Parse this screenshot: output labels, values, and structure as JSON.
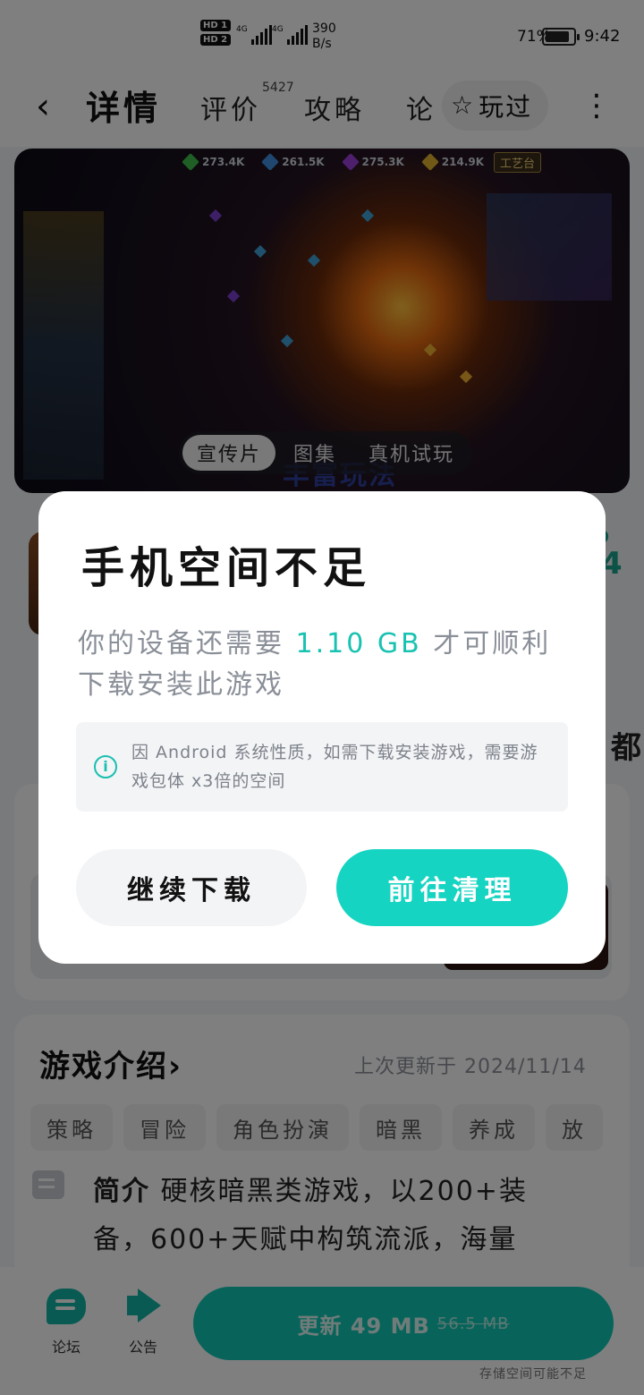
{
  "status_bar": {
    "sim1": "HD 1",
    "sim2": "HD 2",
    "net1": "4G",
    "net2": "4G",
    "speed_value": "390",
    "speed_unit": "B/s",
    "battery": "71%",
    "time": "9:42"
  },
  "header": {
    "tabs": [
      {
        "label": "详情",
        "active": true
      },
      {
        "label": "评价",
        "active": false
      },
      {
        "label": "攻略",
        "active": false
      },
      {
        "label": "论",
        "active": false
      }
    ],
    "review_count": "5427",
    "played_label": "玩过"
  },
  "video": {
    "stats": [
      {
        "value": "273.4K",
        "color": "#3fbf4a"
      },
      {
        "value": "261.5K",
        "color": "#3f8fe0"
      },
      {
        "value": "275.3K",
        "color": "#9b3fd8"
      },
      {
        "value": "214.9K",
        "color": "#e0b02c"
      }
    ],
    "craft_label": "工艺台",
    "caption": "丰富玩法",
    "tabs": [
      {
        "label": "宣传片",
        "active": true
      },
      {
        "label": "图集",
        "active": false
      },
      {
        "label": "真机试玩",
        "active": false
      }
    ]
  },
  "page_bg": {
    "right_badge": "p",
    "right_badge_num": "4",
    "dou": "都",
    "small_left": "《"
  },
  "intro": {
    "title": "游戏介绍",
    "chevron": "›",
    "updated": "上次更新于 2024/11/14",
    "tags": [
      "策略",
      "冒险",
      "角色扮演",
      "暗黑",
      "养成",
      "放"
    ],
    "body_label": "简介",
    "body_text": "硬核暗黑类游戏，以200+装备，600+天赋中构筑流派，海量"
  },
  "bottom_bar": {
    "forum_label": "论坛",
    "notice_label": "公告",
    "update_label": "更新 49 MB",
    "update_old_size": "56.5 MB",
    "storage_note": "存储空间可能不足"
  },
  "dialog": {
    "title": "手机空间不足",
    "message_before": "你的设备还需要 ",
    "required_size": "1.10 GB",
    "message_after": " 才可顺利下载安装此游戏",
    "info_text": "因 Android 系统性质，如需下载安装游戏，需要游戏包体 x3倍的空间",
    "continue_label": "继续下载",
    "clean_label": "前往清理"
  },
  "colors": {
    "accent": "#16d4c2",
    "accent_text": "#18c2b1",
    "overlay": "rgba(0,0,0,0.5)"
  }
}
